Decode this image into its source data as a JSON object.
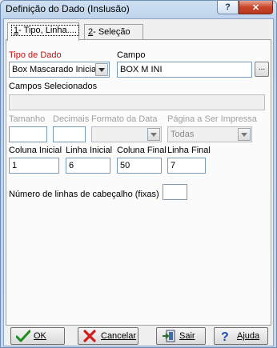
{
  "window": {
    "title": "Definição do Dado (Inslusão)",
    "help_glyph": "?",
    "close_glyph": "✕"
  },
  "tabs": [
    {
      "mnemonic": "1",
      "label": "- Tipo, Linha...."
    },
    {
      "mnemonic": "2",
      "label": "- Seleção"
    }
  ],
  "form": {
    "tipo_label": "Tipo de Dado",
    "tipo_value": "Box Mascarado Inicial",
    "campo_label": "Campo",
    "campo_value": "BOX M INI",
    "campo_button": "...",
    "campos_sel_label": "Campos Selecionados",
    "campos_sel_value": "",
    "tamanho_label": "Tamanho",
    "decimais_label": "Decimais",
    "formato_label": "Formato da Data",
    "pagina_label": "Página a Ser Impressa",
    "pagina_value": "Todas",
    "col_ini_label": "Coluna Inicial",
    "col_ini_value": "1",
    "lin_ini_label": "Linha Inicial",
    "lin_ini_value": "6",
    "col_fin_label": "Coluna Final",
    "col_fin_value": "50",
    "lin_fin_label": "Linha Final",
    "lin_fin_value": "7",
    "header_lines_label": "Número de linhas de cabeçalho (fixas)",
    "header_lines_value": ""
  },
  "buttons": {
    "ok": "OK",
    "cancel": "Cancelar",
    "exit": "Sair",
    "help": "Ajuda"
  },
  "icons": {
    "ok": "check-icon",
    "cancel": "x-icon",
    "exit": "exit-door-icon",
    "help": "question-icon"
  }
}
